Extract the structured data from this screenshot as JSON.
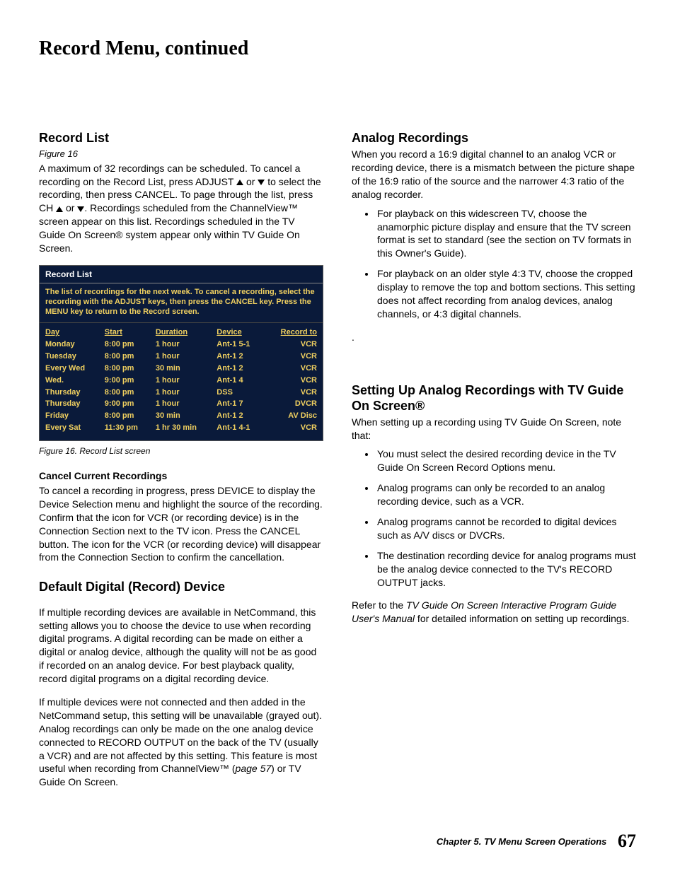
{
  "page_title": "Record Menu, continued",
  "left": {
    "record_list": {
      "heading": "Record List",
      "figure_ref": "Figure 16",
      "para_pre": "A maximum of 32 recordings can be scheduled. To cancel a recording on the Record List, press ADJUST ",
      "para_mid1": " or ",
      "para_mid2": " to select the recording, then press CANCEL.  To page through the list, press CH  ",
      "para_mid3": " or ",
      "para_post": ".  Recordings scheduled from the ChannelView™ screen appear on this list.  Recordings scheduled in the TV Guide On Screen® system appear only within TV Guide On Screen.",
      "box": {
        "title": "Record List",
        "instr": "The list of recordings for the next week.  To cancel a recording, select the recording with the ADJUST keys, then press the CANCEL key.  Press the MENU key to return to the Record screen.",
        "headers": [
          "Day",
          "Start",
          "Duration",
          "Device",
          "Record  to"
        ],
        "rows": [
          [
            "Monday",
            "8:00 pm",
            "1 hour",
            "Ant-1  5-1",
            "VCR"
          ],
          [
            "Tuesday",
            "8:00 pm",
            "1 hour",
            "Ant-1  2",
            "VCR"
          ],
          [
            "Every Wed",
            "8:00 pm",
            "30 min",
            "Ant-1  2",
            "VCR"
          ],
          [
            "Wed.",
            "9:00 pm",
            "1 hour",
            "Ant-1  4",
            "VCR"
          ],
          [
            "Thursday",
            "8:00 pm",
            "1 hour",
            "DSS",
            "VCR"
          ],
          [
            "Thursday",
            "9:00 pm",
            "1 hour",
            "Ant-1  7",
            "DVCR"
          ],
          [
            "Friday",
            "8:00 pm",
            "30 min",
            "Ant-1  2",
            "AV Disc"
          ],
          [
            "Every Sat",
            "11:30 pm",
            "1 hr 30 min",
            "Ant-1  4-1",
            "VCR"
          ]
        ]
      },
      "caption": "Figure 16.  Record List screen",
      "cancel_heading": "Cancel Current Recordings",
      "cancel_para": "To cancel a recording in progress, press DEVICE to display the Device Selection menu and highlight the source of the recording.  Confirm that the icon for VCR (or recording device) is in the Connection Section next to the TV icon. Press the CANCEL button.  The icon for the VCR (or recording device) will disappear from the Connection Section to confirm the cancellation."
    },
    "default_device": {
      "heading": "Default Digital (Record) Device",
      "para1": "If multiple recording devices are available in NetCommand, this setting allows you to choose the device to use when recording digital programs.  A digital recording can be made on either a digital or analog device, although the quality will not be as good if recorded on an analog device.  For best playback quality, record digital programs on a digital recording device.",
      "para2_pre": "If multiple devices were not connected and then added in the NetCommand setup, this setting will be unavailable (grayed out).  Analog recordings can only be made on the one analog device connected to RECORD OUTPUT on the back of the TV (usually a VCR) and are not affected by this setting. This feature is most useful when recording from ChannelView™ (",
      "para2_em": "page 57",
      "para2_post": ") or TV Guide On Screen."
    }
  },
  "right": {
    "analog": {
      "heading": "Analog Recordings",
      "para": "When you record a 16:9 digital channel to an analog VCR or recording device, there is a mismatch between the picture shape of the 16:9 ratio of the source and the narrower 4:3 ratio of the analog recorder.",
      "bullets": [
        "For playback on this widescreen TV, choose the anamorphic picture display and ensure that the TV screen format is set to standard (see the section on TV formats in this Owner's Guide).",
        "For playback on an older style 4:3 TV, choose the cropped display to remove the top and bottom sections.  This setting does not affect recording from analog devices, analog channels, or 4:3 digital channels."
      ],
      "dot": "."
    },
    "setup": {
      "heading": "Setting Up Analog Recordings with TV Guide On Screen®",
      "intro": "When setting up a recording using TV Guide On Screen, note that:",
      "bullets": [
        "You must select the desired recording device in the TV Guide On Screen Record Options menu.",
        "Analog programs can only be recorded to an analog recording device, such as a VCR.",
        "Analog programs cannot be recorded to digital devices such as A/V discs or DVCRs.",
        "The destination recording device for analog programs must be the analog device connected to the TV's RECORD OUTPUT jacks."
      ],
      "ref_pre": "Refer to the ",
      "ref_em": "TV Guide On Screen Interactive Program Guide User's Manual",
      "ref_post": " for detailed information on setting up recordings."
    }
  },
  "footer": {
    "chapter": "Chapter 5. TV Menu Screen Operations",
    "page": "67"
  }
}
